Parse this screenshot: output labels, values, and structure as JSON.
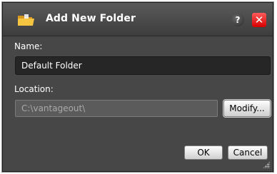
{
  "dialog": {
    "title": "Add New Folder",
    "icons": {
      "folder": "folder-icon",
      "help": "help-icon",
      "close": "close-icon"
    },
    "help_glyph": "?",
    "close_glyph": "✕"
  },
  "name": {
    "label": "Name:",
    "value": "Default Folder"
  },
  "location": {
    "label": "Location:",
    "value": "C:\\vantageout\\",
    "modify_label": "Modify..."
  },
  "buttons": {
    "ok": "OK",
    "cancel": "Cancel"
  },
  "colors": {
    "background": "#474747",
    "close_button": "#e01010",
    "text": "#ffffff"
  }
}
